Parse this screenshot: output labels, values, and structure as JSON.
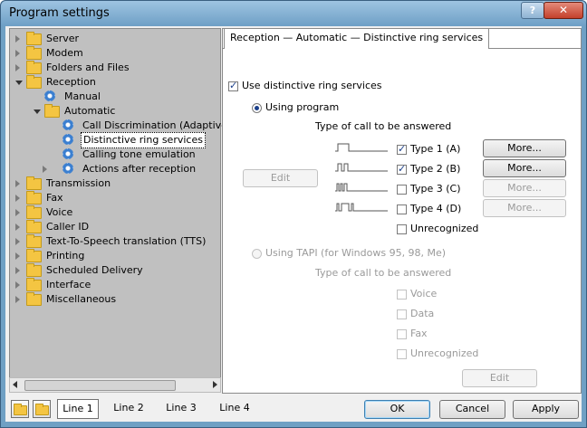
{
  "window": {
    "title": "Program settings",
    "help_label": "?",
    "close_label": "✕"
  },
  "tree": {
    "items": [
      {
        "label": "Server"
      },
      {
        "label": "Modem"
      },
      {
        "label": "Folders and Files"
      },
      {
        "label": "Reception"
      },
      {
        "label": "Manual"
      },
      {
        "label": "Automatic"
      },
      {
        "label": "Call Discrimination (Adaptive"
      },
      {
        "label": "Distinctive ring services"
      },
      {
        "label": "Calling tone emulation"
      },
      {
        "label": "Actions after reception"
      },
      {
        "label": "Transmission"
      },
      {
        "label": "Fax"
      },
      {
        "label": "Voice"
      },
      {
        "label": "Caller ID"
      },
      {
        "label": "Text-To-Speech translation (TTS)"
      },
      {
        "label": "Printing"
      },
      {
        "label": "Scheduled Delivery"
      },
      {
        "label": "Interface"
      },
      {
        "label": "Miscellaneous"
      }
    ]
  },
  "panel": {
    "tab_title": "Reception — Automatic — Distinctive ring services",
    "use_distinctive": "Use distinctive ring services",
    "using_program": "Using program",
    "type_of_call": "Type of call to be answered",
    "edit_label": "Edit",
    "types": [
      {
        "label": "Type 1 (A)",
        "checked": true,
        "more": "More..."
      },
      {
        "label": "Type 2 (B)",
        "checked": true,
        "more": "More..."
      },
      {
        "label": "Type 3 (C)",
        "checked": false,
        "more": "More..."
      },
      {
        "label": "Type 4 (D)",
        "checked": false,
        "more": "More..."
      }
    ],
    "unrecognized": "Unrecognized",
    "using_tapi": "Using TAPI (for Windows 95, 98, Me)",
    "tapi_type_of_call": "Type of call to be answered",
    "tapi_options": [
      "Voice",
      "Data",
      "Fax",
      "Unrecognized"
    ],
    "tapi_edit": "Edit"
  },
  "bottom": {
    "line_tabs": [
      "Line 1",
      "Line 2",
      "Line 3",
      "Line 4"
    ],
    "ok": "OK",
    "cancel": "Cancel",
    "apply": "Apply"
  }
}
